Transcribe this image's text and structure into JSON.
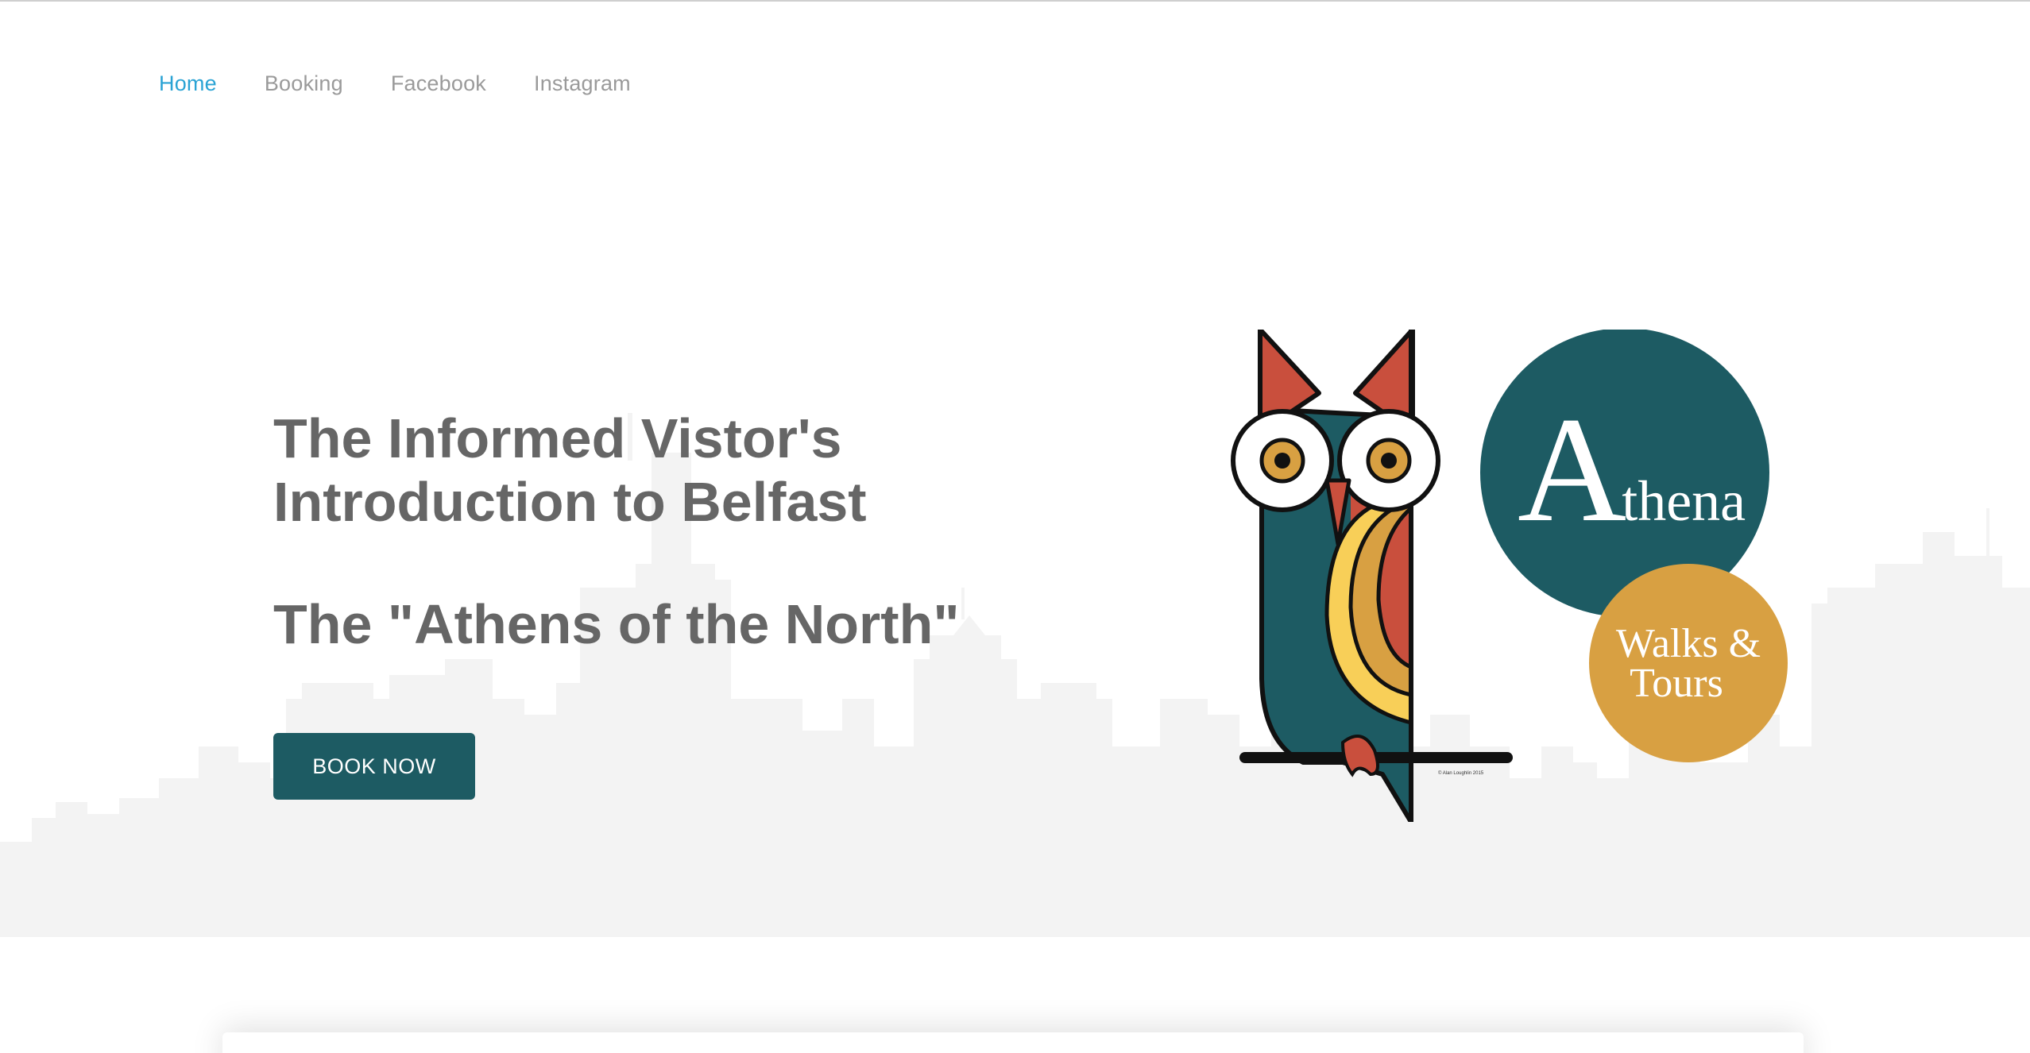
{
  "nav": {
    "items": [
      {
        "label": "Home",
        "active": true
      },
      {
        "label": "Booking",
        "active": false
      },
      {
        "label": "Facebook",
        "active": false
      },
      {
        "label": "Instagram",
        "active": false
      }
    ]
  },
  "hero": {
    "headline_line1": "The Informed Vistor's",
    "headline_line2": "Introduction to Belfast",
    "subheadline": "The \"Athens of the North\"",
    "cta_label": "BOOK NOW"
  },
  "logo": {
    "brand_name": "Athena",
    "tagline_line1": "Walks &",
    "tagline_line2": "Tours",
    "credit": "© Alan Loughlin 2015",
    "icon": "owl-icon"
  },
  "colors": {
    "accent_nav": "#2aa3d4",
    "teal": "#1d5b63",
    "gold": "#d8a042",
    "red": "#c94f3d",
    "yellow": "#f8cf58",
    "text_gray": "#666666",
    "skyline_gray": "#f2f2f2"
  }
}
